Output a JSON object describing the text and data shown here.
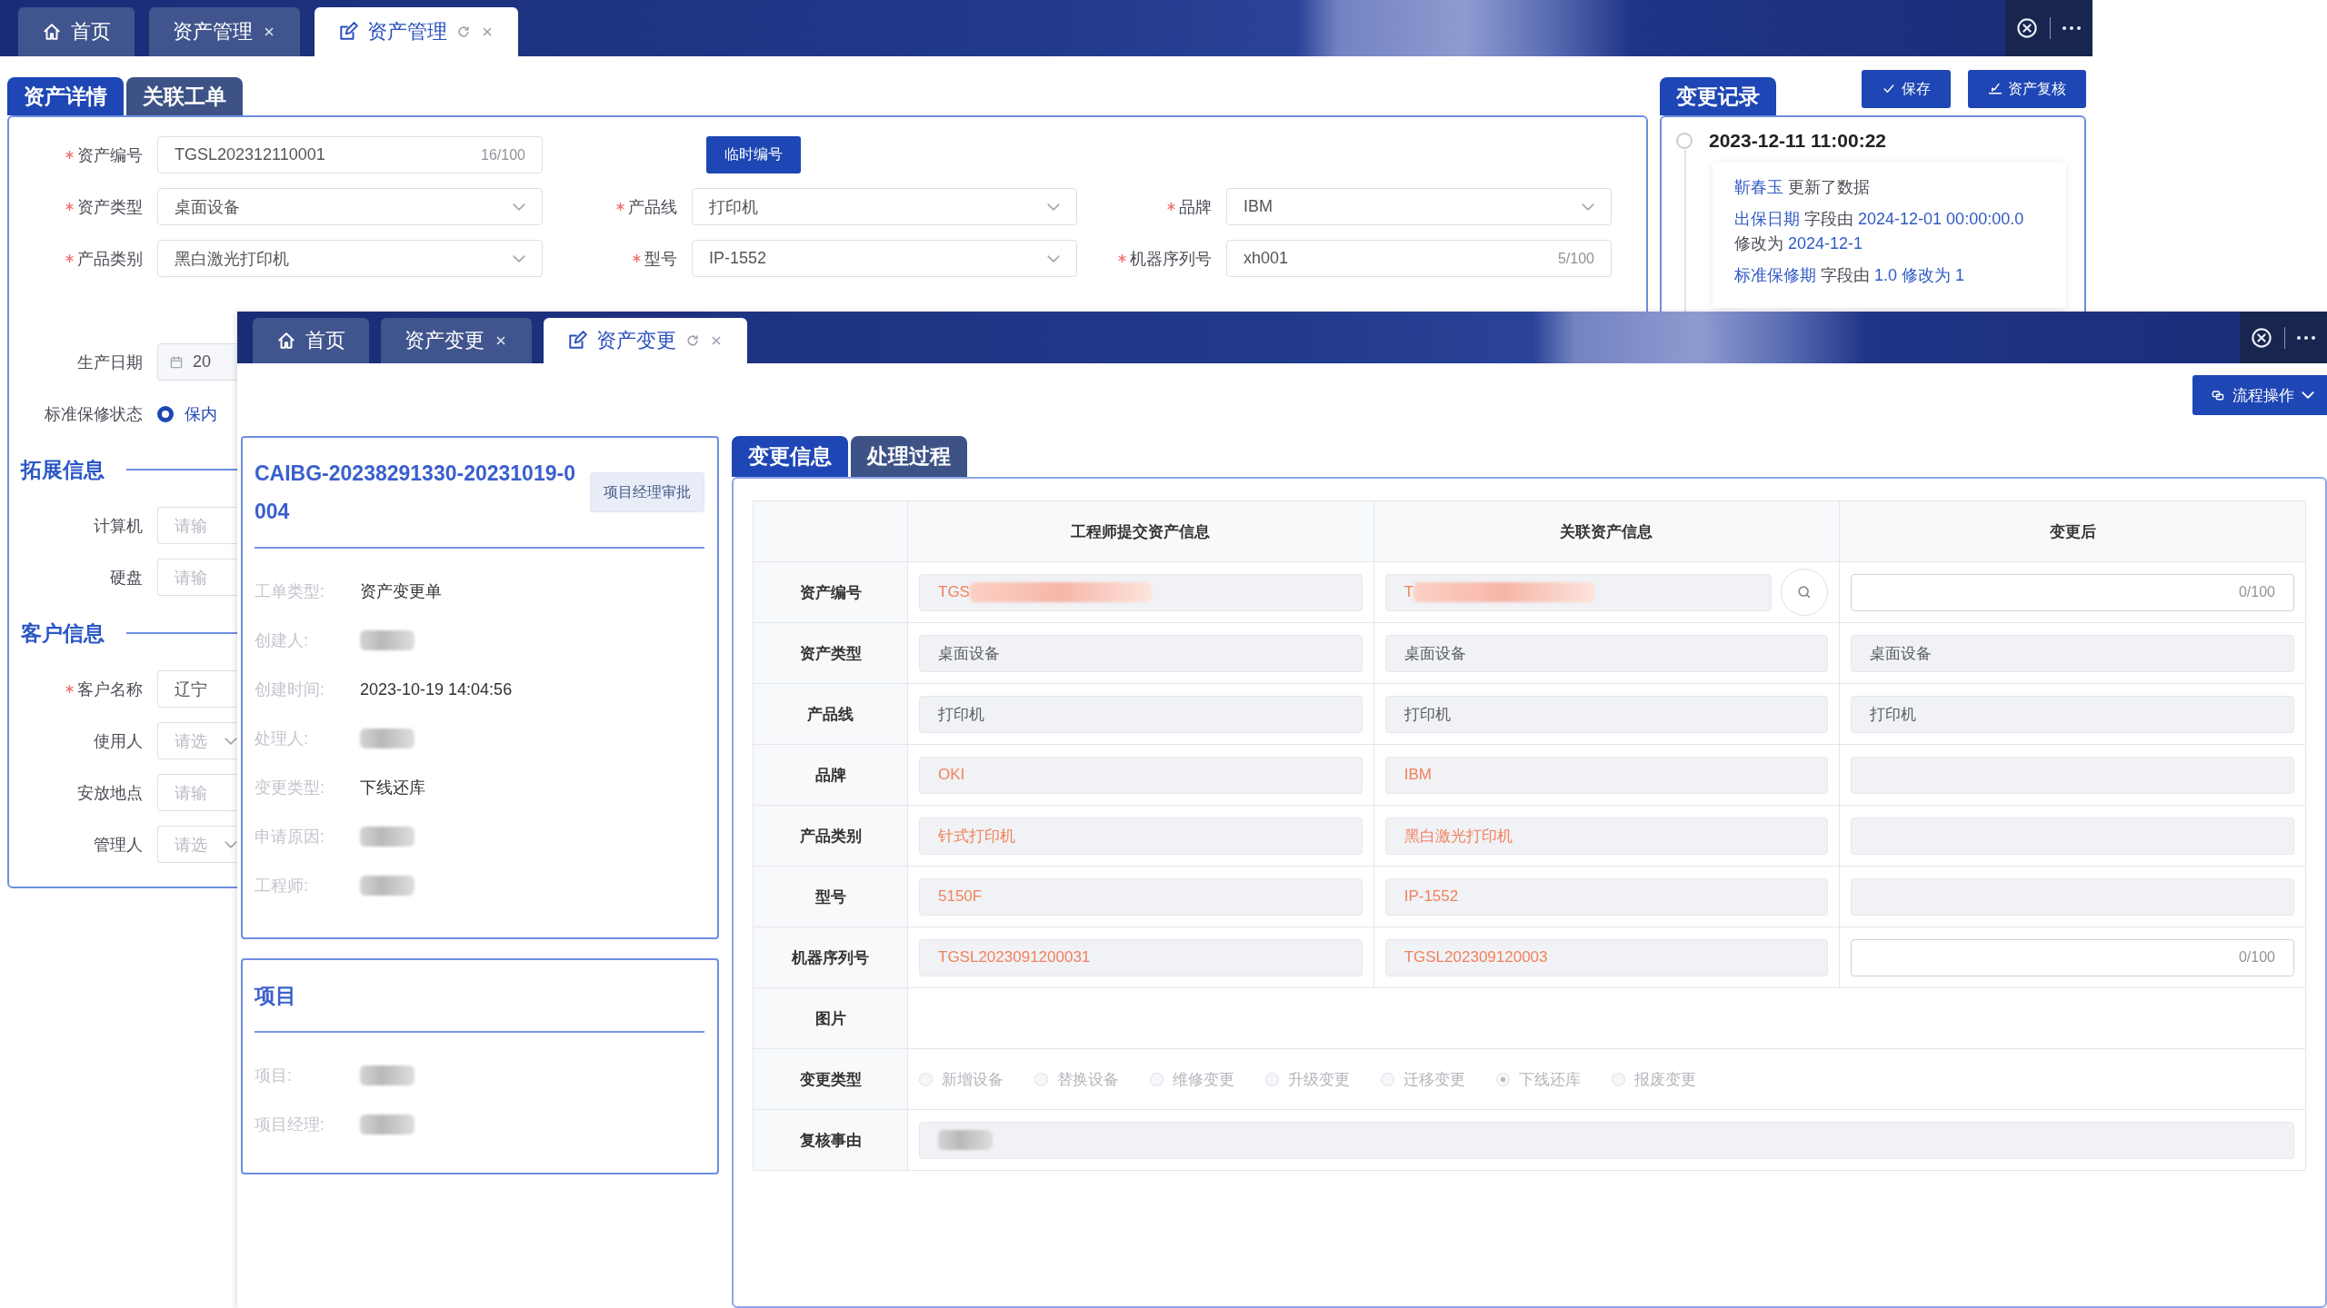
{
  "back_window": {
    "tabs": [
      {
        "kind": "home",
        "label": "首页",
        "closable": false,
        "refreshable": false,
        "selected": false
      },
      {
        "kind": "page",
        "label": "资产管理",
        "closable": true,
        "refreshable": false,
        "selected": false
      },
      {
        "kind": "editor",
        "label": "资产管理",
        "closable": true,
        "refreshable": true,
        "selected": true
      }
    ],
    "detail_tabs": [
      {
        "label": "资产详情",
        "selected": true
      },
      {
        "label": "关联工单",
        "selected": false
      }
    ],
    "form_grid": [
      {
        "fields": [
          {
            "kind": "input",
            "label": "资产编号",
            "required": true,
            "value": "TGSL202312110001",
            "counter": "16/100"
          },
          {
            "kind": "button",
            "text": "临时编号"
          }
        ]
      },
      {
        "fields": [
          {
            "kind": "select",
            "label": "资产类型",
            "required": true,
            "value": "桌面设备"
          },
          {
            "kind": "select",
            "label": "产品线",
            "required": true,
            "value": "打印机"
          },
          {
            "kind": "select",
            "label": "品牌",
            "required": true,
            "value": "IBM"
          }
        ]
      },
      {
        "fields": [
          {
            "kind": "select",
            "label": "产品类别",
            "required": true,
            "value": "黑白激光打印机"
          },
          {
            "kind": "select",
            "label": "型号",
            "required": true,
            "value": "IP-1552"
          },
          {
            "kind": "input",
            "label": "机器序列号",
            "required": true,
            "value": "xh001",
            "counter": "5/100"
          }
        ]
      }
    ],
    "form_column": [
      {
        "kind": "date",
        "label": "生产日期",
        "required": false,
        "value": "20"
      },
      {
        "kind": "radio",
        "label": "标准保修状态",
        "required": false,
        "options": [
          {
            "label": "保内",
            "selected": true
          }
        ]
      },
      {
        "kind": "section",
        "title": "拓展信息"
      },
      {
        "kind": "input",
        "label": "计算机",
        "required": false,
        "placeholder": "请输"
      },
      {
        "kind": "input",
        "label": "硬盘",
        "required": false,
        "placeholder": "请输"
      },
      {
        "kind": "section",
        "title": "客户信息"
      },
      {
        "kind": "input",
        "label": "客户名称",
        "required": true,
        "value": "辽宁"
      },
      {
        "kind": "select",
        "label": "使用人",
        "required": false,
        "placeholder": "请选"
      },
      {
        "kind": "input",
        "label": "安放地点",
        "required": false,
        "placeholder": "请输"
      },
      {
        "kind": "select",
        "label": "管理人",
        "required": false,
        "placeholder": "请选"
      }
    ],
    "record_tab": "变更记录",
    "buttons": [
      {
        "kind": "save",
        "label": "保存"
      },
      {
        "kind": "review",
        "label": "资产复核"
      }
    ],
    "record": {
      "time": "2023-12-11 11:00:22",
      "lines": [
        [
          {
            "text": "靳春玉",
            "highlight": true
          },
          {
            "text": "更新了数据",
            "highlight": false
          }
        ],
        [
          {
            "text": "出保日期",
            "highlight": true
          },
          {
            "text": "字段由",
            "highlight": false
          },
          {
            "text": "2024-12-01 00:00:00.0",
            "highlight": true
          },
          {
            "text": "修改为",
            "highlight": false
          },
          {
            "text": "2024-12-1",
            "highlight": true
          }
        ],
        [
          {
            "text": "标准保修期",
            "highlight": true
          },
          {
            "text": "字段由",
            "highlight": false
          },
          {
            "text": "1.0",
            "highlight": true
          },
          {
            "text": "修改为",
            "highlight": true
          },
          {
            "text": "1",
            "highlight": true
          }
        ]
      ]
    }
  },
  "front_window": {
    "tabs": [
      {
        "kind": "home",
        "label": "首页",
        "closable": false,
        "refreshable": false,
        "selected": false
      },
      {
        "kind": "page",
        "label": "资产变更",
        "closable": true,
        "refreshable": false,
        "selected": false
      },
      {
        "kind": "editor",
        "label": "资产变更",
        "closable": true,
        "refreshable": true,
        "selected": true
      }
    ],
    "flow_button": "流程操作",
    "order_card": {
      "title": "CAIBG-20238291330-20231019-0004",
      "status": "项目经理审批",
      "rows": [
        {
          "label": "工单类型:",
          "value": "资产变更单"
        },
        {
          "label": "创建人:",
          "redacted": true
        },
        {
          "label": "创建时间:",
          "value": "2023-10-19 14:04:56"
        },
        {
          "label": "处理人:",
          "redacted": true
        },
        {
          "label": "变更类型:",
          "value": "下线还库"
        },
        {
          "label": "申请原因:",
          "redacted": true
        },
        {
          "label": "工程师:",
          "redacted": true
        }
      ]
    },
    "project_card": {
      "title": "项目",
      "rows": [
        {
          "label": "项目:",
          "redacted": true
        },
        {
          "label": "项目经理:",
          "redacted": true
        }
      ]
    },
    "change_tabs": [
      {
        "label": "变更信息",
        "selected": true
      },
      {
        "label": "处理过程",
        "selected": false
      }
    ],
    "table": {
      "columns": [
        "工程师提交资产信息",
        "关联资产信息",
        "变更后"
      ],
      "rows": [
        {
          "kind": "fields",
          "label": "资产编号",
          "cells": [
            {
              "value": "TGS",
              "changed": true,
              "redacted": true,
              "editable": false
            },
            {
              "value": "T",
              "changed": true,
              "redacted": true,
              "search": true,
              "editable": false
            },
            {
              "counter": "0/100",
              "editable": true
            }
          ]
        },
        {
          "kind": "fields",
          "label": "资产类型",
          "cells": [
            {
              "value": "桌面设备",
              "changed": false
            },
            {
              "value": "桌面设备",
              "changed": false
            },
            {
              "value": "桌面设备",
              "changed": false
            }
          ]
        },
        {
          "kind": "fields",
          "label": "产品线",
          "cells": [
            {
              "value": "打印机",
              "changed": false
            },
            {
              "value": "打印机",
              "changed": false
            },
            {
              "value": "打印机",
              "changed": false
            }
          ]
        },
        {
          "kind": "fields",
          "label": "品牌",
          "cells": [
            {
              "value": "OKI",
              "changed": true
            },
            {
              "value": "IBM",
              "changed": true
            },
            {
              "editable": false
            }
          ]
        },
        {
          "kind": "fields",
          "label": "产品类别",
          "cells": [
            {
              "value": "针式打印机",
              "changed": true
            },
            {
              "value": "黑白激光打印机",
              "changed": true
            },
            {
              "editable": false
            }
          ]
        },
        {
          "kind": "fields",
          "label": "型号",
          "cells": [
            {
              "value": "5150F",
              "changed": true
            },
            {
              "value": "IP-1552",
              "changed": true
            },
            {
              "editable": false
            }
          ]
        },
        {
          "kind": "fields",
          "label": "机器序列号",
          "cells": [
            {
              "value": "TGSL2023091200031",
              "changed": true
            },
            {
              "value": "TGSL202309120003",
              "changed": true
            },
            {
              "counter": "0/100",
              "editable": true
            }
          ]
        },
        {
          "kind": "image",
          "label": "图片"
        },
        {
          "kind": "radio",
          "label": "变更类型",
          "options": [
            {
              "label": "新增设备",
              "selected": false
            },
            {
              "label": "替换设备",
              "selected": false
            },
            {
              "label": "维修变更",
              "selected": false
            },
            {
              "label": "升级变更",
              "selected": false
            },
            {
              "label": "迁移变更",
              "selected": false
            },
            {
              "label": "下线还库",
              "selected": true
            },
            {
              "label": "报废变更",
              "selected": false
            }
          ]
        },
        {
          "kind": "text",
          "label": "复核事由",
          "redacted": true
        }
      ]
    }
  }
}
